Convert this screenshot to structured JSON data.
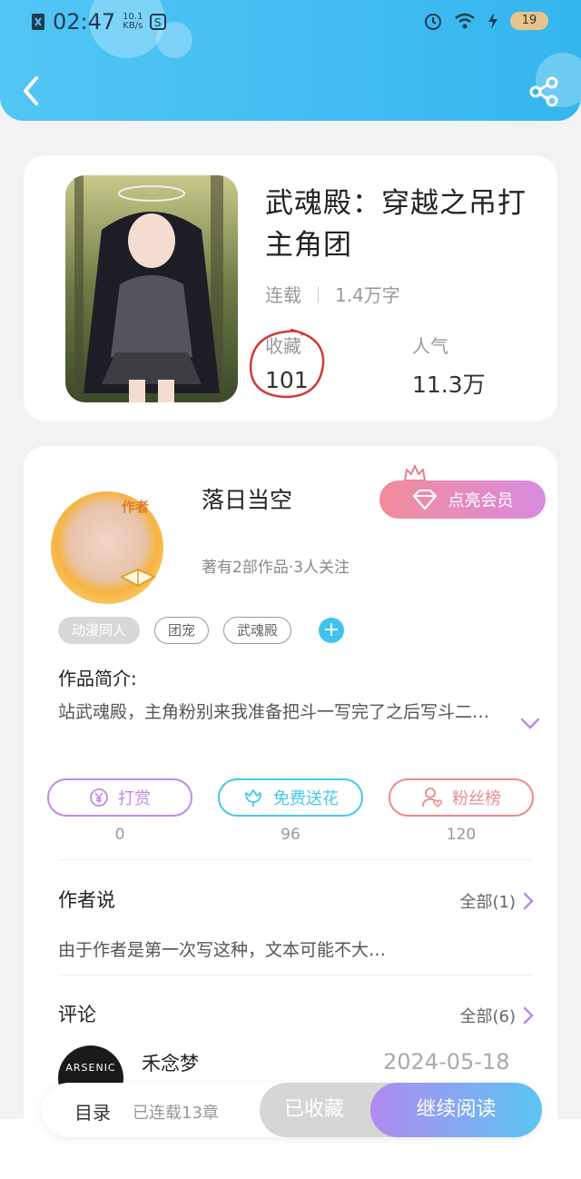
{
  "status_bar": {
    "time": "02:47",
    "net_speed": "10.1",
    "net_unit": "KB/s",
    "battery": "19"
  },
  "book": {
    "title": "武魂殿：穿越之吊打主角团",
    "status": "连载",
    "word_count": "1.4万字",
    "favorites_label": "收藏",
    "favorites_value": "101",
    "popularity_label": "人气",
    "popularity_value": "11.3万"
  },
  "author": {
    "name": "落日当空",
    "avatar_badge": "作者",
    "sub": "著有2部作品·3人关注",
    "vip_label": "点亮会员",
    "tags": [
      "动漫同人",
      "团宠",
      "武魂殿"
    ],
    "intro_title": "作品简介:",
    "intro_text": "站武魂殿，主角粉别来我准备把斗一写完了之后写斗二…"
  },
  "actions": [
    {
      "label": "打赏",
      "count": "0",
      "color": "#c08ae6"
    },
    {
      "label": "免费送花",
      "count": "96",
      "color": "#45c7ee"
    },
    {
      "label": "粉丝榜",
      "count": "120",
      "color": "#ee8a8a"
    }
  ],
  "author_says": {
    "title": "作者说",
    "more": "全部(1)",
    "text": "由于作者是第一次写这种，文本可能不大…"
  },
  "comments": {
    "title": "评论",
    "more": "全部(6)",
    "first": {
      "name": "禾念梦",
      "date": "2024-05-18",
      "avatar_text": "ARSENIC"
    }
  },
  "bottom_bar": {
    "toc": "目录",
    "toc_sub": "已连载13章",
    "collected": "已收藏",
    "continue": "继续阅读"
  }
}
